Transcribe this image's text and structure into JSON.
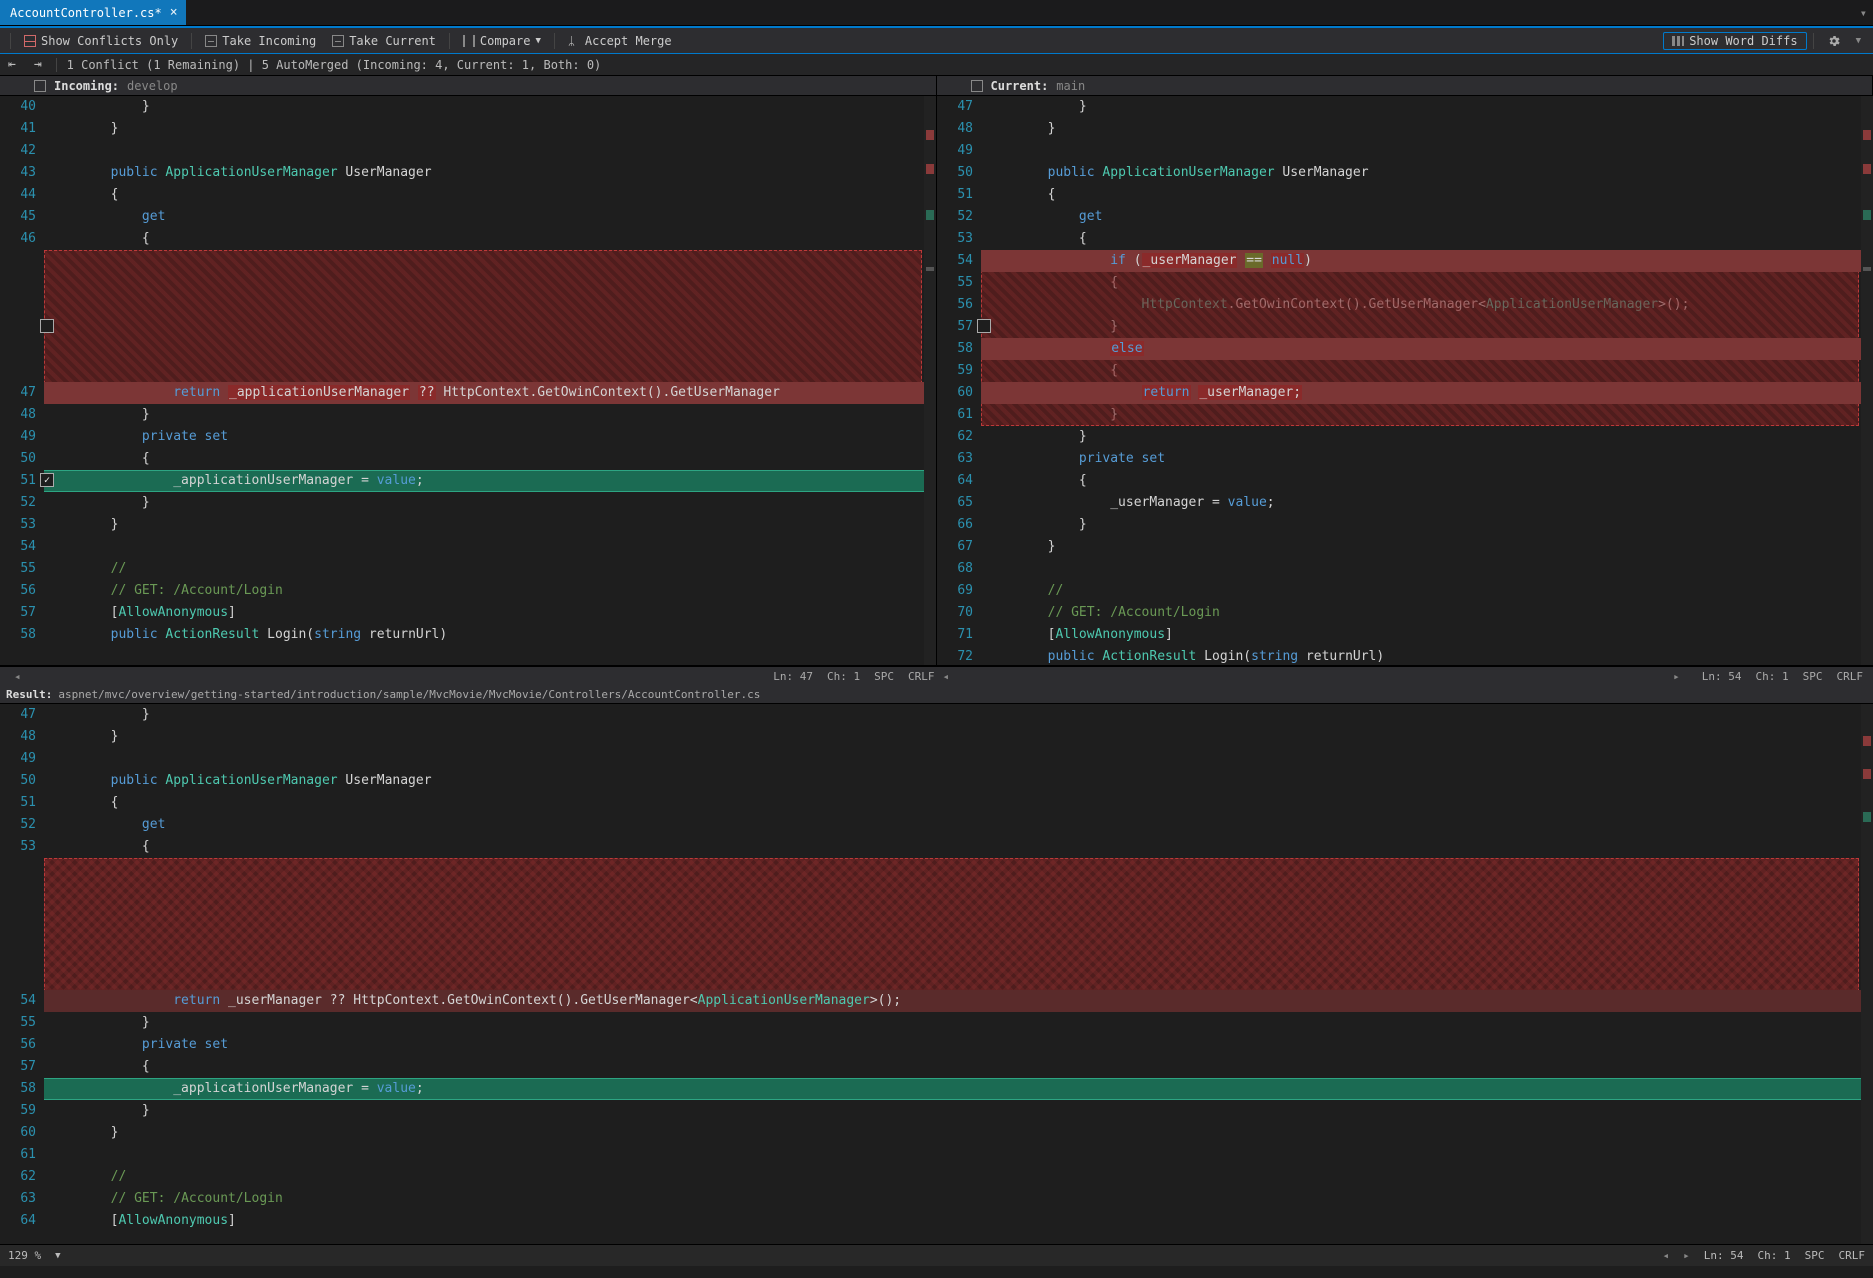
{
  "tab": {
    "name": "AccountController.cs*",
    "closeGlyph": "×"
  },
  "toolbarBtns": {
    "showConflicts": "Show Conflicts Only",
    "takeIncoming": "Take Incoming",
    "takeCurrent": "Take Current",
    "compare": "Compare",
    "acceptMerge": "Accept Merge",
    "showWordDiffs": "Show Word Diffs"
  },
  "nav": {
    "summary": "1 Conflict (1 Remaining) | 5 AutoMerged (Incoming: 4, Current: 1, Both: 0)",
    "prev": "⇤",
    "next": "⇥"
  },
  "panes": {
    "incoming": {
      "label": "Incoming:",
      "branch": "develop"
    },
    "current": {
      "label": "Current:",
      "branch": "main"
    }
  },
  "incoming": {
    "startLine": 40,
    "lines": [
      "            }",
      "        }",
      "",
      "        public ApplicationUserManager UserManager",
      "        {",
      "            get",
      "            {",
      "                return _applicationUserManager ?? HttpContext.GetOwinContext().GetUserManager",
      "            }",
      "            private set",
      "            {",
      "                _applicationUserManager = value;",
      "            }",
      "        }",
      "",
      "        //",
      "        // GET: /Account/Login",
      "        [AllowAnonymous]",
      "        public ActionResult Login(string returnUrl)"
    ],
    "status": {
      "ln": "Ln: 47",
      "ch": "Ch: 1",
      "ws": "SPC",
      "eol": "CRLF"
    }
  },
  "current": {
    "startLine": 47,
    "lines": [
      "            }",
      "        }",
      "",
      "        public ApplicationUserManager UserManager",
      "        {",
      "            get",
      "            {",
      "                if (_userManager == null)",
      "                {",
      "                    HttpContext.GetOwinContext().GetUserManager<ApplicationUserManager>();",
      "                }",
      "                else",
      "                {",
      "                    return _userManager;",
      "                }",
      "            }",
      "            private set",
      "            {",
      "                _userManager = value;",
      "            }",
      "        }",
      "",
      "        //",
      "        // GET: /Account/Login",
      "        [AllowAnonymous]",
      "        public ActionResult Login(string returnUrl)"
    ],
    "status": {
      "ln": "Ln: 54",
      "ch": "Ch: 1",
      "ws": "SPC",
      "eol": "CRLF"
    }
  },
  "result": {
    "label": "Result:",
    "path": "aspnet/mvc/overview/getting-started/introduction/sample/MvcMovie/MvcMovie/Controllers/AccountController.cs",
    "startLine": 47,
    "lines": [
      "            }",
      "        }",
      "",
      "        public ApplicationUserManager UserManager",
      "        {",
      "            get",
      "            {",
      "                return _userManager ?? HttpContext.GetOwinContext().GetUserManager<ApplicationUserManager>();",
      "            }",
      "            private set",
      "            {",
      "                _applicationUserManager = value;",
      "            }",
      "        }",
      "",
      "        //",
      "        // GET: /Account/Login",
      "        [AllowAnonymous]"
    ]
  },
  "statusbar": {
    "zoom": "129 %",
    "ln": "Ln: 54",
    "ch": "Ch: 1",
    "ws": "SPC",
    "eol": "CRLF"
  }
}
